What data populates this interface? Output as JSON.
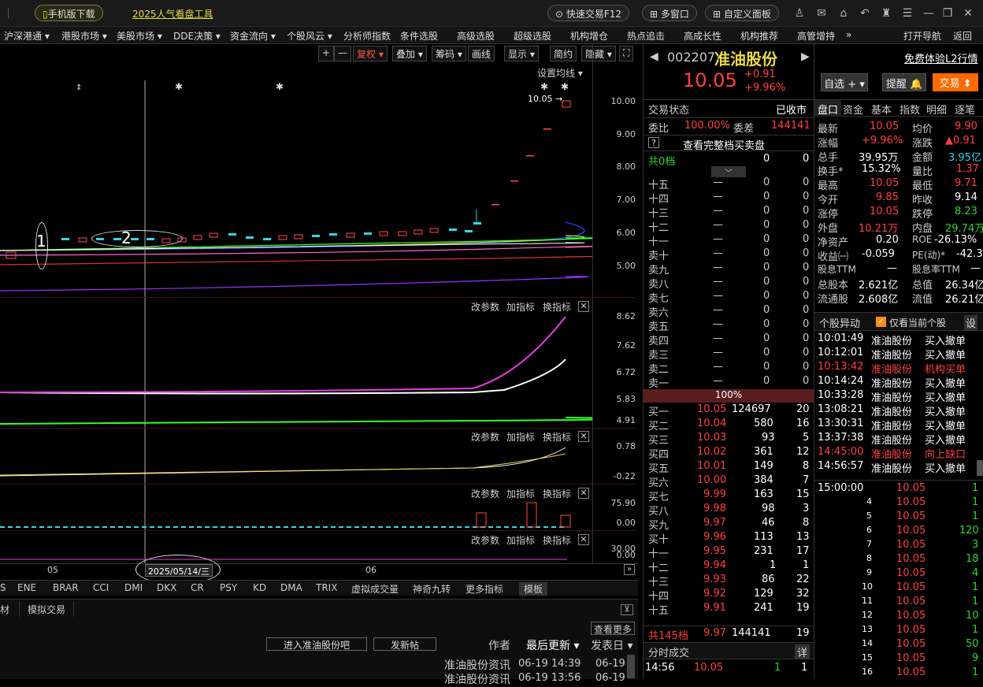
{
  "topbar": {
    "mobile_download": "手机版下载",
    "ad_link": "2025人气看盘工具",
    "quick_trade": "快速交易F12",
    "multi_window": "多窗口",
    "custom_panel": "自定义面板"
  },
  "menu": [
    "沪深港通 ▾",
    "港股市场 ▾",
    "美股市场 ▾",
    "DDE决策 ▾",
    "资金流向 ▾",
    "个股风云 ▾",
    "分析师指数",
    "条件选股",
    "高级选股",
    "超级选股",
    "机构增仓",
    "热点追击",
    "高成长性",
    "机构推荐",
    "高管增持",
    "»",
    "打开导航",
    "返回"
  ],
  "toolbar": {
    "plus": "+",
    "minus": "—",
    "fuquan": "复权 ▾",
    "diejia": "叠加 ▾",
    "chouma": "筹码 ▾",
    "huaxian": "画线",
    "xianshi": "显示 ▾",
    "jiantou": "简约",
    "yincang": "隐藏 ▾",
    "fullscreen": "⛶"
  },
  "main_chart": {
    "ma_setting": "设置均线 ▾",
    "price_tag": "10.05",
    "axis": [
      "10.00",
      "9.00",
      "8.00",
      "7.00",
      "6.00",
      "5.00"
    ]
  },
  "panels": [
    {
      "links": [
        "改参数",
        "加指标",
        "换指标"
      ],
      "axis": [
        "8.62",
        "7.62",
        "6.72",
        "5.83",
        "4.91"
      ]
    },
    {
      "links": [
        "改参数",
        "加指标",
        "换指标"
      ],
      "axis": [
        "0.78",
        "-0.22"
      ]
    },
    {
      "links": [
        "改参数",
        "加指标",
        "换指标"
      ],
      "axis": [
        "75.90",
        "0.00"
      ]
    },
    {
      "links": [
        "改参数",
        "加指标",
        "换指标"
      ],
      "axis": [
        "30.00",
        "0.00"
      ]
    }
  ],
  "xaxis": {
    "m1": "05",
    "cursor_date": "2025/05/14/三",
    "m2": "06"
  },
  "annotations": {
    "a1": "1",
    "a2": "2"
  },
  "indicators": [
    "S",
    "ENE",
    "BRAR",
    "CCI",
    "DMI",
    "DKX",
    "CR",
    "PSY",
    "KD",
    "DMA",
    "TRIX",
    "虚拟成交量",
    "神奇九转",
    "更多指标",
    "模板"
  ],
  "bottom": {
    "tab1": "材",
    "tab2": "模拟交易",
    "more": "查看更多",
    "enter_bar": "进入准油股份吧",
    "post": "发新帖",
    "author": "作者",
    "latest": "最后更新 ▾",
    "published": "发表日 ▾",
    "news": [
      [
        "准油股份资讯",
        "06-19 14:39",
        "06-19"
      ],
      [
        "准油股份资讯",
        "06-19 13:56",
        "06-19"
      ]
    ]
  },
  "stock": {
    "code": "002207",
    "name": "准油股份",
    "free_l2": "免费体验L2行情",
    "price": "10.05",
    "change": "+0.91",
    "pct": "+9.96%",
    "zixuan": "自选 + ▾",
    "tixing": "提醒 🔔",
    "trade": "交易 ⬍"
  },
  "orderbook": {
    "status_label": "交易状态",
    "status": "已收市",
    "weibi_label": "委比",
    "weibi": "100.00%",
    "weicha_label": "委差",
    "weicha": "144141",
    "full_book": "查看完整档买卖盘",
    "q_mark": "?",
    "total_sell": [
      "共0档",
      "0",
      "0"
    ],
    "sells": [
      [
        "十五",
        "—",
        "0",
        "0"
      ],
      [
        "十四",
        "—",
        "0",
        "0"
      ],
      [
        "十三",
        "—",
        "0",
        "0"
      ],
      [
        "十二",
        "—",
        "0",
        "0"
      ],
      [
        "十一",
        "—",
        "0",
        "0"
      ],
      [
        "卖十",
        "—",
        "0",
        "0"
      ],
      [
        "卖九",
        "—",
        "0",
        "0"
      ],
      [
        "卖八",
        "—",
        "0",
        "0"
      ],
      [
        "卖七",
        "—",
        "0",
        "0"
      ],
      [
        "卖六",
        "—",
        "0",
        "0"
      ],
      [
        "卖五",
        "—",
        "0",
        "0"
      ],
      [
        "卖四",
        "—",
        "0",
        "0"
      ],
      [
        "卖三",
        "—",
        "0",
        "0"
      ],
      [
        "卖二",
        "—",
        "0",
        "0"
      ],
      [
        "卖一",
        "—",
        "0",
        "0"
      ]
    ],
    "mid_pct": "100%",
    "buys": [
      [
        "买一",
        "10.05",
        "124697",
        "20"
      ],
      [
        "买二",
        "10.04",
        "580",
        "16"
      ],
      [
        "买三",
        "10.03",
        "93",
        "5"
      ],
      [
        "买四",
        "10.02",
        "361",
        "12"
      ],
      [
        "买五",
        "10.01",
        "149",
        "8"
      ],
      [
        "买六",
        "10.00",
        "384",
        "7"
      ],
      [
        "买七",
        "9.99",
        "163",
        "15"
      ],
      [
        "买八",
        "9.98",
        "98",
        "3"
      ],
      [
        "买九",
        "9.97",
        "46",
        "8"
      ],
      [
        "买十",
        "9.96",
        "113",
        "13"
      ],
      [
        "十一",
        "9.95",
        "231",
        "17"
      ],
      [
        "十二",
        "9.94",
        "1",
        "1"
      ],
      [
        "十三",
        "9.93",
        "86",
        "22"
      ],
      [
        "十四",
        "9.92",
        "129",
        "32"
      ],
      [
        "十五",
        "9.91",
        "241",
        "19"
      ]
    ],
    "total_buy": [
      "共145档",
      "9.97",
      "144141",
      "19"
    ],
    "fenshi_label": "分时成交",
    "detail": "详",
    "last_trade": [
      "14:56",
      "10.05",
      "1",
      "1"
    ]
  },
  "quote_tabs": [
    "盘口",
    "资金",
    "基本",
    "指数",
    "明细",
    "逐笔"
  ],
  "quote": [
    [
      "最新",
      "10.05",
      "均价",
      "9.90"
    ],
    [
      "涨幅",
      "+9.96%",
      "涨跌",
      "▲0.91"
    ],
    [
      "总手",
      "39.95万",
      "金额",
      "3.95亿"
    ],
    [
      "换手*",
      "15.32%",
      "量比",
      "1.37"
    ],
    [
      "最高",
      "10.05",
      "最低",
      "9.71"
    ],
    [
      "今开",
      "9.85",
      "昨收",
      "9.14"
    ],
    [
      "涨停",
      "10.05",
      "跌停",
      "8.23"
    ],
    [
      "外盘",
      "10.21万",
      "内盘",
      "29.74万"
    ],
    [
      "净资产",
      "0.20",
      "ROE",
      "-26.13%"
    ],
    [
      "收益㈠",
      "-0.059",
      "PE(动)*",
      "-42.3"
    ],
    [
      "股息TTM",
      "—",
      "股息率TTM",
      "—"
    ],
    [
      "总股本",
      "2.621亿",
      "总值",
      "26.34亿"
    ],
    [
      "流通股",
      "2.608亿",
      "流值",
      "26.21亿"
    ]
  ],
  "abnormal": {
    "title": "个股异动",
    "only_current": "仅看当前个股",
    "settings": "设",
    "rows": [
      [
        "10:01:49",
        "准油股份",
        "买入撤单"
      ],
      [
        "10:12:01",
        "准油股份",
        "买入撤单"
      ],
      [
        "10:13:42",
        "准油股份",
        "机构买单"
      ],
      [
        "10:14:24",
        "准油股份",
        "买入撤单"
      ],
      [
        "10:33:28",
        "准油股份",
        "买入撤单"
      ],
      [
        "13:08:21",
        "准油股份",
        "买入撤单"
      ],
      [
        "13:30:31",
        "准油股份",
        "买入撤单"
      ],
      [
        "13:37:38",
        "准油股份",
        "买入撤单"
      ],
      [
        "14:45:00",
        "准油股份",
        "向上缺口"
      ],
      [
        "14:56:57",
        "准油股份",
        "买入撤单"
      ]
    ]
  },
  "ticks": [
    [
      "15:00:00",
      "10.05",
      "1"
    ],
    [
      "4",
      "10.05",
      "1"
    ],
    [
      "5",
      "10.05",
      "1"
    ],
    [
      "6",
      "10.05",
      "120"
    ],
    [
      "7",
      "10.05",
      "3"
    ],
    [
      "8",
      "10.05",
      "18"
    ],
    [
      "9",
      "10.05",
      "4"
    ],
    [
      "10",
      "10.05",
      "1"
    ],
    [
      "11",
      "10.05",
      "1"
    ],
    [
      "12",
      "10.05",
      "10"
    ],
    [
      "13",
      "10.05",
      "1"
    ],
    [
      "14",
      "10.05",
      "50"
    ],
    [
      "15",
      "10.05",
      "9"
    ],
    [
      "16",
      "10.05",
      "1"
    ]
  ]
}
